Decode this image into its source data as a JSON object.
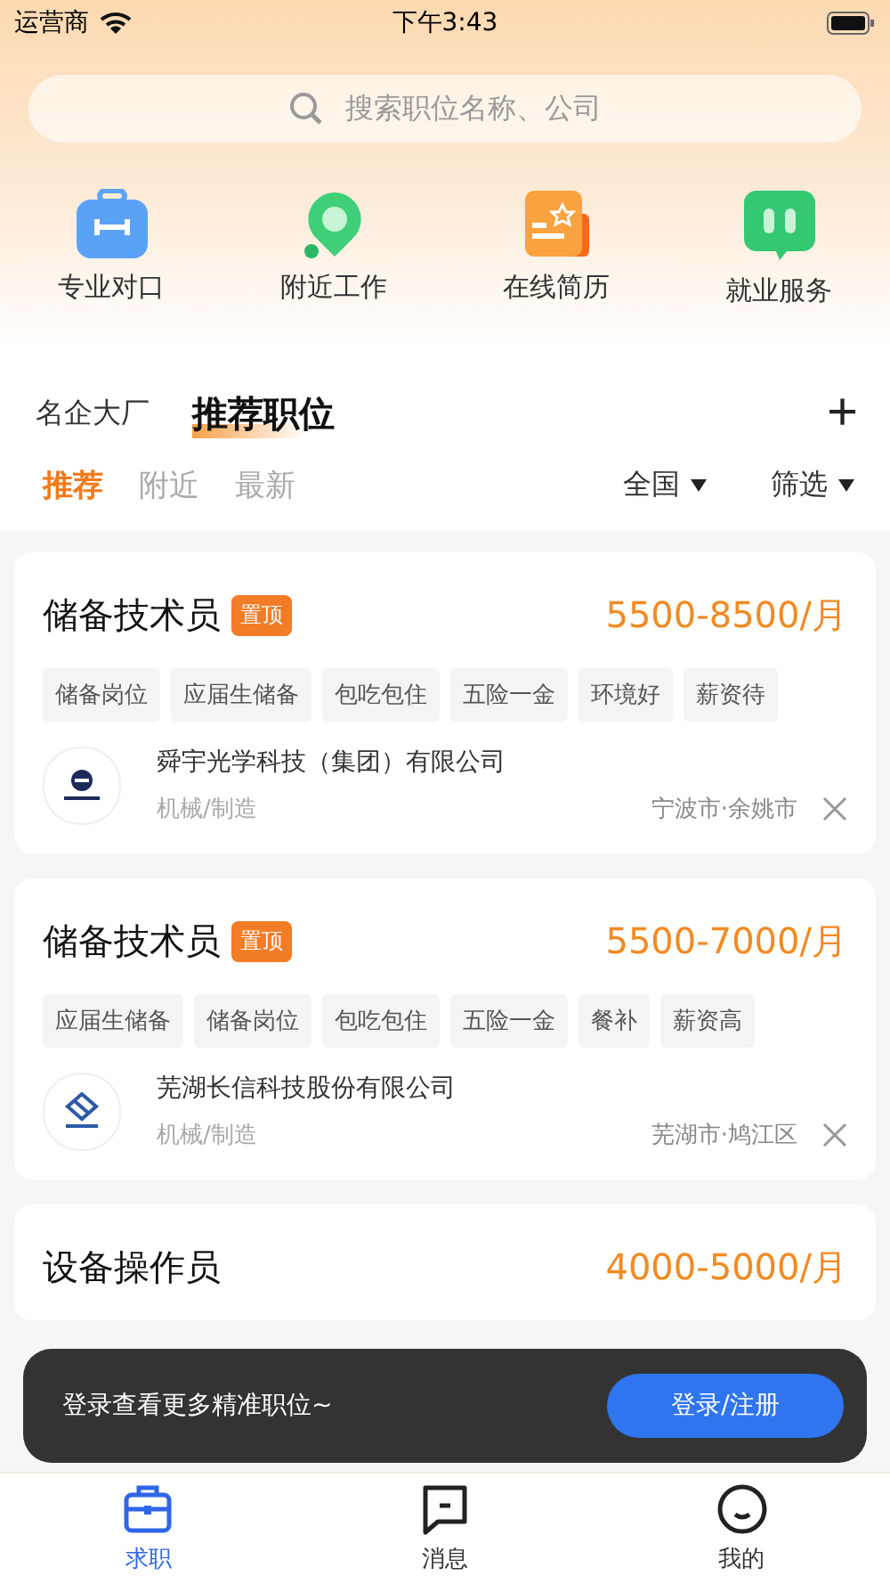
{
  "status_bar": {
    "carrier": "运营商",
    "time": "下午3:43"
  },
  "search": {
    "placeholder": "搜索职位名称、公司"
  },
  "shortcuts": [
    {
      "label": "专业对口",
      "kind": "toolbox"
    },
    {
      "label": "附近工作",
      "kind": "pin"
    },
    {
      "label": "在线简历",
      "kind": "resume"
    },
    {
      "label": "就业服务",
      "kind": "chat"
    }
  ],
  "section_tabs": [
    {
      "label": "名企大厂",
      "selected": false
    },
    {
      "label": "推荐职位",
      "selected": true
    }
  ],
  "add_button": "+",
  "filter_tabs": [
    {
      "label": "推荐",
      "selected": true
    },
    {
      "label": "附近",
      "selected": false
    },
    {
      "label": "最新",
      "selected": false
    }
  ],
  "dropdowns": [
    "全国",
    "筛选"
  ],
  "jobs": [
    {
      "title": "储备技术员",
      "badge": "置顶",
      "salary": "5500-8500/月",
      "tags": [
        "储备岗位",
        "应届生储备",
        "包吃包住",
        "五险一金",
        "环境好",
        "薪资待"
      ],
      "company": "舜宇光学科技（集团）有限公司",
      "industry": "机械/制造",
      "location": "宁波市·余姚市"
    },
    {
      "title": "储备技术员",
      "badge": "置顶",
      "salary": "5500-7000/月",
      "tags": [
        "应届生储备",
        "储备岗位",
        "包吃包住",
        "五险一金",
        "餐补",
        "薪资高"
      ],
      "company": "芜湖长信科技股份有限公司",
      "industry": "机械/制造",
      "location": "芜湖市·鸠江区"
    },
    {
      "title": "设备操作员",
      "salary": "4000-5000/月"
    }
  ],
  "login_banner": {
    "text": "登录查看更多精准职位~",
    "button": "登录/注册"
  },
  "bottom_nav": [
    {
      "label": "求职",
      "kind": "briefcase",
      "selected": true
    },
    {
      "label": "消息",
      "kind": "message",
      "selected": false
    },
    {
      "label": "我的",
      "kind": "profile",
      "selected": false
    }
  ]
}
